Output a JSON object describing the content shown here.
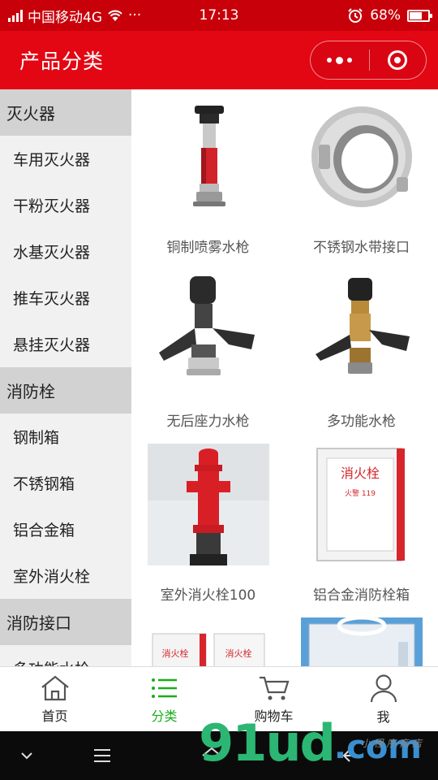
{
  "status_bar": {
    "carrier": "中国移动4G",
    "dots": "···",
    "time": "17:13",
    "battery": "68%",
    "battery_level": 0.68
  },
  "header": {
    "title": "产品分类"
  },
  "sidebar": {
    "items": [
      {
        "label": "灭火器",
        "kind": "category"
      },
      {
        "label": "车用灭火器",
        "kind": "sub"
      },
      {
        "label": "干粉灭火器",
        "kind": "sub"
      },
      {
        "label": "水基灭火器",
        "kind": "sub"
      },
      {
        "label": "推车灭火器",
        "kind": "sub"
      },
      {
        "label": "悬挂灭火器",
        "kind": "sub"
      },
      {
        "label": "消防栓",
        "kind": "category"
      },
      {
        "label": "钢制箱",
        "kind": "sub"
      },
      {
        "label": "不锈钢箱",
        "kind": "sub"
      },
      {
        "label": "铝合金箱",
        "kind": "sub"
      },
      {
        "label": "室外消火栓",
        "kind": "sub"
      },
      {
        "label": "消防接口",
        "kind": "category"
      },
      {
        "label": "多功能水枪",
        "kind": "sub"
      }
    ]
  },
  "products": [
    {
      "label": "铜制喷雾水枪",
      "icon": "spray-nozzle-icon"
    },
    {
      "label": "不锈钢水带接口",
      "icon": "hose-coupling-icon"
    },
    {
      "label": "无后座力水枪",
      "icon": "recoilless-nozzle-icon"
    },
    {
      "label": "多功能水枪",
      "icon": "multi-function-nozzle-icon"
    },
    {
      "label": "室外消火栓100",
      "icon": "outdoor-hydrant-icon"
    },
    {
      "label": "铝合金消防栓箱",
      "icon": "hydrant-cabinet-icon"
    },
    {
      "label": "",
      "icon": "hydrant-cabinet-pair-icon"
    },
    {
      "label": "",
      "icon": "hydrant-cabinet-open-icon"
    }
  ],
  "cabinet_text": {
    "sign": "消火栓",
    "phone": "火警 119",
    "sign_short": "消火栓"
  },
  "tabbar": {
    "items": [
      {
        "label": "首页",
        "icon": "home-icon"
      },
      {
        "label": "分类",
        "icon": "list-icon",
        "active": true
      },
      {
        "label": "购物车",
        "icon": "cart-icon"
      },
      {
        "label": "我",
        "icon": "user-icon"
      }
    ]
  },
  "watermark": {
    "main": "91ud",
    "domain": ".com",
    "small": "小 程 序 商 店"
  },
  "colors": {
    "brand_red": "#e30613",
    "status_red": "#c8000a",
    "active_green": "#1aad19"
  }
}
